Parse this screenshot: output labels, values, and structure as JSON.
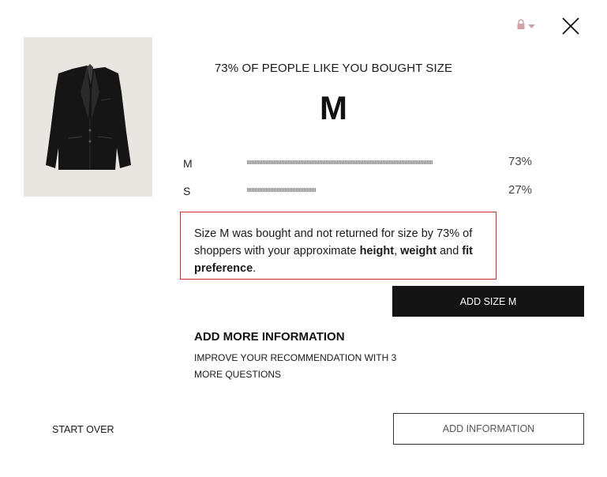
{
  "header": {
    "lang_icon": "lock-icon",
    "dropdown_icon": "caret-down-icon",
    "close_icon": "close-icon"
  },
  "product": {
    "image_icon": "black-blazer-image"
  },
  "recommendation": {
    "headline": "73% OF PEOPLE LIKE YOU BOUGHT SIZE",
    "size": "M",
    "breakdown": [
      {
        "size": "M",
        "percent_label": "73%",
        "share": 0.73
      },
      {
        "size": "S",
        "percent_label": "27%",
        "share": 0.27
      }
    ],
    "explanation": {
      "part1": "Size M was bought and not returned for size by 73% of shoppers with your approximate ",
      "bold1": "height",
      "sep1": ", ",
      "bold2": "weight",
      "sep2": " and ",
      "bold3": "fit preference",
      "end": "."
    },
    "add_size_label": "ADD SIZE M"
  },
  "more_info": {
    "title": "ADD MORE INFORMATION",
    "line1": "IMPROVE YOUR RECOMMENDATION WITH 3",
    "line2": "MORE QUESTIONS"
  },
  "footer": {
    "start_over_label": "START OVER",
    "add_information_label": "ADD INFORMATION"
  },
  "colors": {
    "highlight_border": "#cf2a2a",
    "primary_button": "#141414",
    "image_background": "#e9e6e2"
  }
}
